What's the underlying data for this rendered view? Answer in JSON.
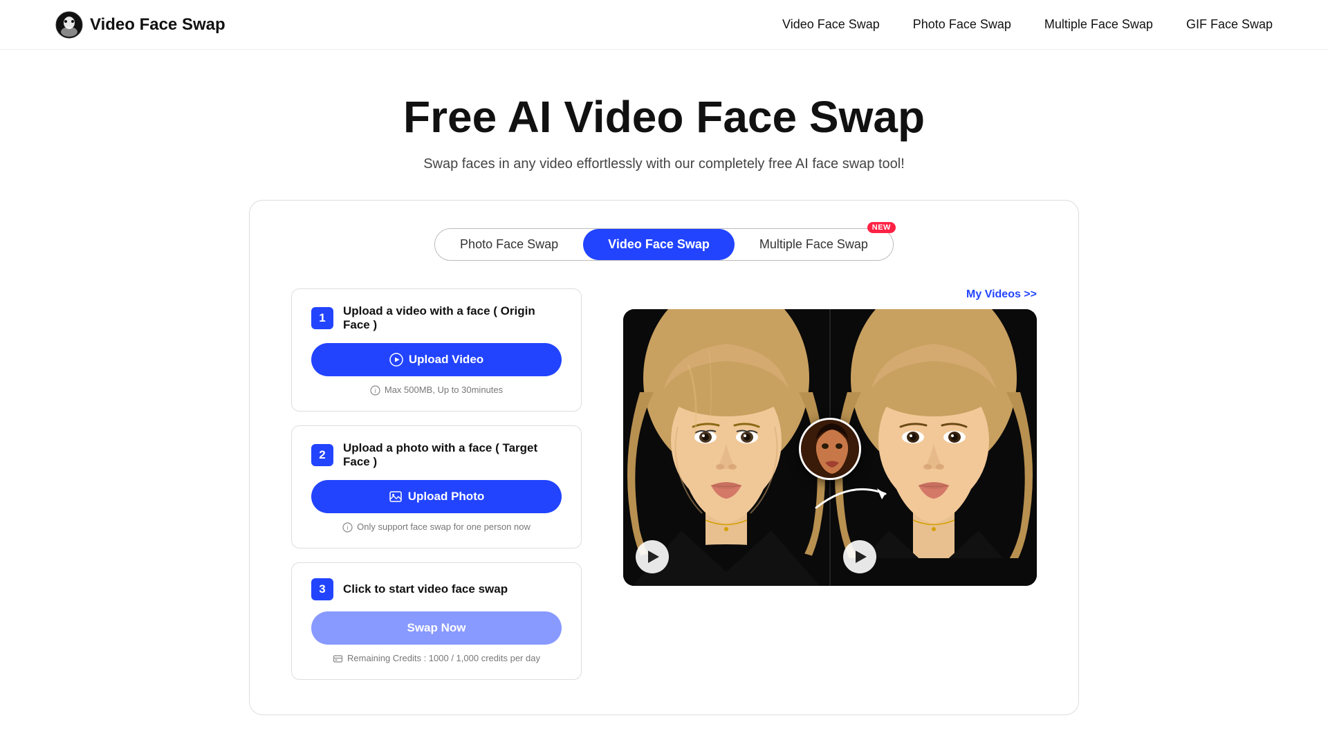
{
  "nav": {
    "logo_text": "Video Face Swap",
    "links": [
      {
        "label": "Video Face Swap",
        "href": "#"
      },
      {
        "label": "Photo Face Swap",
        "href": "#"
      },
      {
        "label": "Multiple Face Swap",
        "href": "#"
      },
      {
        "label": "GIF Face Swap",
        "href": "#"
      }
    ]
  },
  "hero": {
    "title": "Free AI Video Face Swap",
    "subtitle": "Swap faces in any video effortlessly with our completely free AI face swap tool!"
  },
  "tabs": [
    {
      "label": "Photo Face Swap",
      "active": false,
      "new": false
    },
    {
      "label": "Video Face Swap",
      "active": true,
      "new": false
    },
    {
      "label": "Multiple Face Swap",
      "active": false,
      "new": true
    }
  ],
  "my_videos_link": "My Videos >>",
  "steps": [
    {
      "number": "1",
      "title": "Upload a video with a face ( Origin Face )",
      "button_label": "Upload Video",
      "note": "Max 500MB, Up to 30minutes"
    },
    {
      "number": "2",
      "title": "Upload a photo with a face ( Target Face )",
      "button_label": "Upload Photo",
      "note": "Only support face swap for one person now"
    },
    {
      "number": "3",
      "title": "Click to start video face swap",
      "button_label": "Swap Now",
      "note": "Remaining Credits : 1000 / 1,000 credits per day"
    }
  ],
  "new_badge": "NEW",
  "colors": {
    "primary": "#2244ff",
    "danger": "#ff2244"
  }
}
